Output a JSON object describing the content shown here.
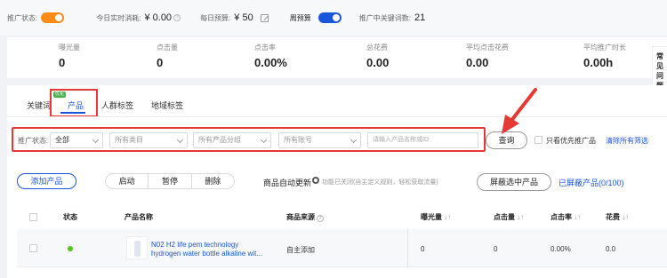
{
  "topbar": {
    "promo_status_label": "推广状态:",
    "today_spend_label": "今日实时消耗:",
    "today_spend_value": "¥ 0.00",
    "daily_budget_label": "每日预算:",
    "daily_budget_value": "¥ 50",
    "weekly_budget_label": "周预算",
    "keyword_count_label": "推广中关键词数:",
    "keyword_count_value": "21",
    "colors": {
      "toggle_orange": "#fa8c16",
      "toggle_blue": "#1a56db"
    }
  },
  "stats": [
    {
      "label": "曝光量",
      "value": "0"
    },
    {
      "label": "点击量",
      "value": "0"
    },
    {
      "label": "点击率",
      "value": "0.00%"
    },
    {
      "label": "总花费",
      "value": "0.00"
    },
    {
      "label": "平均点击花费",
      "value": "0.00"
    },
    {
      "label": "平均推广时长",
      "value": "0.00h"
    }
  ],
  "help_panel": {
    "line1": "常",
    "line2": "见",
    "line3": "问",
    "line4": "题"
  },
  "tabs": {
    "keywords": "关键词",
    "products": "产品",
    "products_badge": "优化",
    "audience": "人群标签",
    "region": "地域标签"
  },
  "filters": {
    "status_label": "推广状态:",
    "status_value": "全部",
    "category_placeholder": "所有类目",
    "group_placeholder": "所有产品分组",
    "account_placeholder": "所有账号",
    "search_placeholder": "请输入产品名称或ID",
    "query_button": "查询",
    "only_priority_label": "只看优先推广品",
    "clear_all_link": "清除所有筛选"
  },
  "actions": {
    "add_product": "添加产品",
    "start": "启动",
    "pause": "暂停",
    "delete": "删除",
    "auto_update_title": "商品自动更新",
    "auto_update_desc": "功能已关闭(自主定义规则，轻松获取流量)",
    "hide_selected": "屏蔽选中产品",
    "hidden_products_link": "已屏蔽产品(0/100)"
  },
  "table": {
    "headers": {
      "status": "状态",
      "product_name": "产品名称",
      "product_source": "商品来源",
      "impressions": "曝光量",
      "clicks": "点击量",
      "ctr": "点击率",
      "cost": "花费",
      "sort_glyph": "↓↑"
    },
    "rows": [
      {
        "status_color": "#52c41a",
        "product_name": "N02 H2 life pem technology hydrogen water bottle alkaline wit...",
        "source": "自主添加",
        "impressions": "0",
        "clicks": "0",
        "ctr": "0.00%",
        "cost": "0.0"
      }
    ]
  }
}
